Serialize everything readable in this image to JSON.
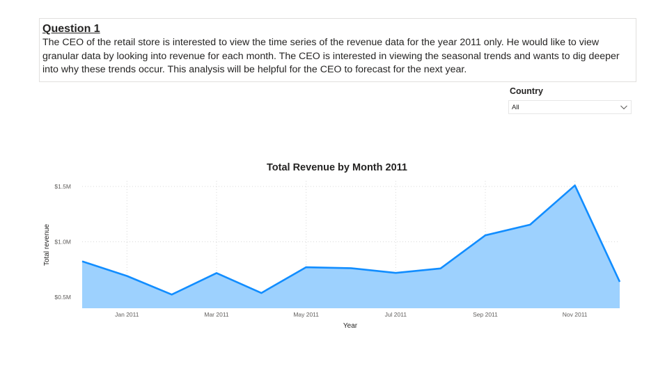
{
  "question": {
    "title": "Question 1",
    "body": "The CEO of the retail store is interested to view the time series of the revenue data for the year 2011 only. He would like to view granular data by looking into revenue for each month. The CEO is interested in viewing the seasonal trends and wants to dig deeper into why these trends occur. This analysis will be helpful for the CEO to forecast for the next year."
  },
  "slicer": {
    "label": "Country",
    "selected": "All",
    "icon": "chevron-down-icon"
  },
  "colors": {
    "line": "#118DFF",
    "fill": "#9DD1FE",
    "grid": "#d9d9d9"
  },
  "chart_data": {
    "type": "area",
    "title": "Total Revenue by Month 2011",
    "xlabel": "Year",
    "ylabel": "Total revenue",
    "x": [
      "2010-12",
      "2011-01",
      "2011-02",
      "2011-03",
      "2011-04",
      "2011-05",
      "2011-06",
      "2011-07",
      "2011-08",
      "2011-09",
      "2011-10",
      "2011-11",
      "2011-12"
    ],
    "values": [
      823746,
      691364,
      523631,
      717639,
      537809,
      770537,
      761740,
      719221,
      759138,
      1058590,
      1154979,
      1509496,
      638793
    ],
    "x_tick_labels": [
      "Jan 2011",
      "Mar 2011",
      "May 2011",
      "Jul 2011",
      "Sep 2011",
      "Nov 2011"
    ],
    "x_tick_indices": [
      1,
      3,
      5,
      7,
      9,
      11
    ],
    "y_ticks": [
      500000,
      1000000,
      1500000
    ],
    "y_tick_labels": [
      "$0.5M",
      "$1.0M",
      "$1.5M"
    ],
    "ylim": [
      400000,
      1550000
    ],
    "grid": true,
    "legend": "none"
  }
}
